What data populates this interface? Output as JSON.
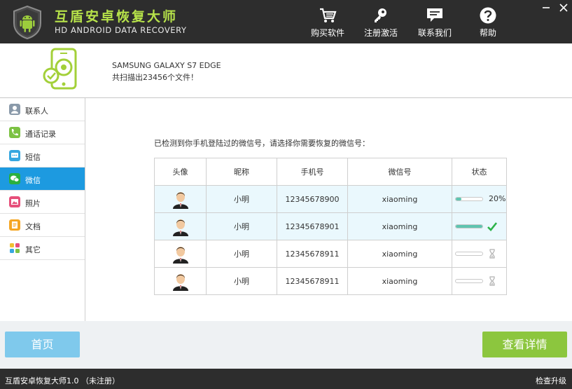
{
  "header": {
    "title": "互盾安卓恢复大师",
    "subtitle": "HD ANDROID DATA RECOVERY",
    "nav": [
      {
        "label": "购买软件",
        "icon": "cart-icon"
      },
      {
        "label": "注册激活",
        "icon": "key-icon"
      },
      {
        "label": "联系我们",
        "icon": "chat-icon"
      },
      {
        "label": "帮助",
        "icon": "help-icon"
      }
    ]
  },
  "device": {
    "name": "SAMSUNG GALAXY S7 EDGE",
    "scan_result": "共扫描出23456个文件！"
  },
  "sidebar": {
    "items": [
      {
        "label": "联系人",
        "icon": "contacts-icon",
        "color": "#8a9aaa"
      },
      {
        "label": "通话记录",
        "icon": "call-log-icon",
        "color": "#7cc243"
      },
      {
        "label": "短信",
        "icon": "sms-icon",
        "color": "#37a7e0"
      },
      {
        "label": "微信",
        "icon": "wechat-icon",
        "color": "#2ab03e"
      },
      {
        "label": "照片",
        "icon": "photo-icon",
        "color": "#e64f7a"
      },
      {
        "label": "文档",
        "icon": "document-icon",
        "color": "#f5a623"
      },
      {
        "label": "其它",
        "icon": "other-icon",
        "color": "#f0c030"
      }
    ],
    "active_index": 3
  },
  "content": {
    "prompt": "已检测到你手机登陆过的微信号，请选择你需要恢复的微信号：",
    "columns": [
      "头像",
      "昵称",
      "手机号",
      "微信号",
      "状态"
    ],
    "rows": [
      {
        "nickname": "小明",
        "phone": "12345678900",
        "wechat": "xiaoming",
        "progress": 0.2,
        "status_text": "20%",
        "state": "progress"
      },
      {
        "nickname": "小明",
        "phone": "12345678901",
        "wechat": "xiaoming",
        "progress": 1.0,
        "status_text": "",
        "state": "done"
      },
      {
        "nickname": "小明",
        "phone": "12345678911",
        "wechat": "xiaoming",
        "progress": 0.0,
        "status_text": "",
        "state": "waiting"
      },
      {
        "nickname": "小明",
        "phone": "12345678911",
        "wechat": "xiaoming",
        "progress": 0.0,
        "status_text": "",
        "state": "waiting"
      }
    ]
  },
  "buttons": {
    "home": "首页",
    "detail": "查看详情"
  },
  "statusbar": {
    "version": "互盾安卓恢复大师1.0 （未注册）",
    "update": "检查升级"
  },
  "colors": {
    "accent_green": "#8cc63e",
    "accent_blue": "#1d9ae0",
    "header_bg": "#2d2d2d",
    "title_green": "#b7e34a"
  }
}
